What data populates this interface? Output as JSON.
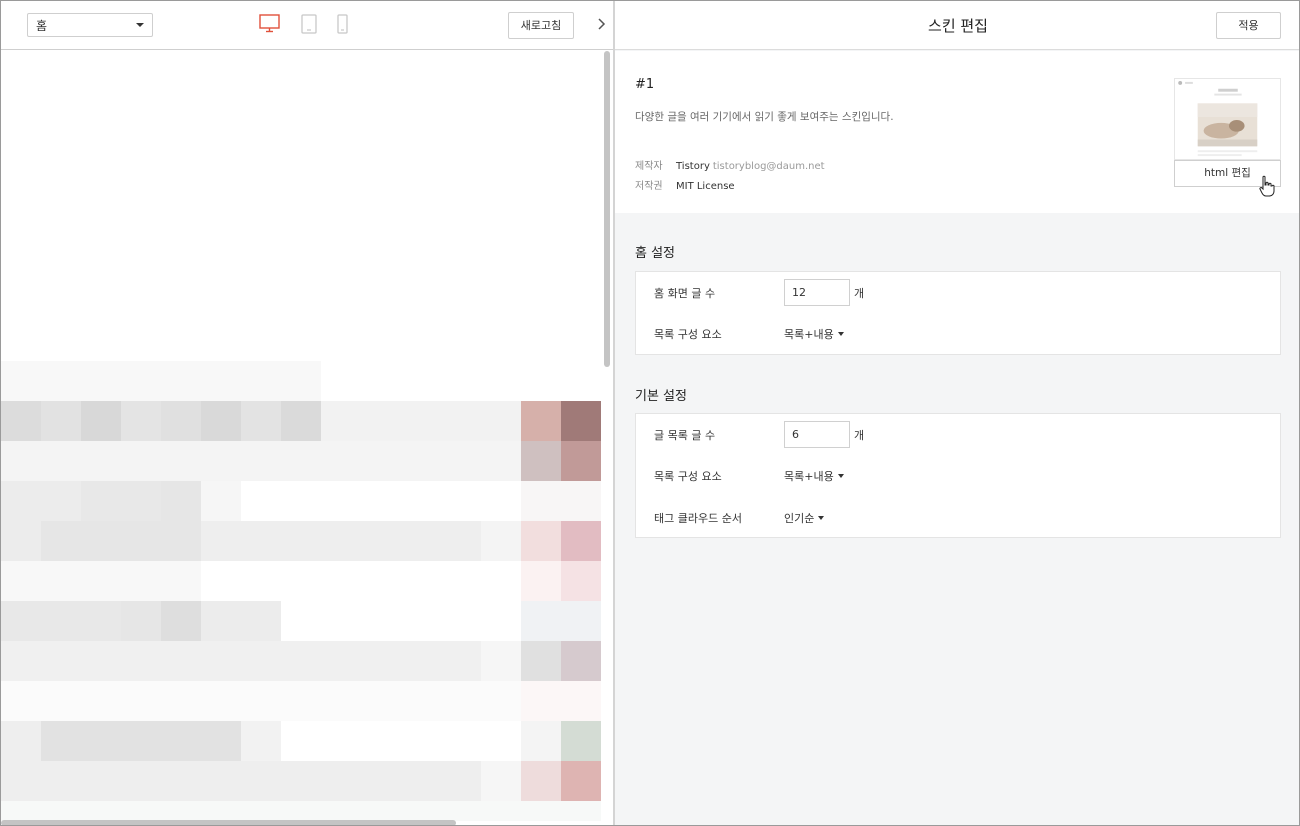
{
  "preview": {
    "page_select": "홈",
    "refresh_label": "새로고침"
  },
  "editor": {
    "title": "스킨 편집",
    "apply_label": "적용",
    "skin": {
      "number": "#1",
      "description": "다양한 글을 여러 기기에서 읽기 좋게 보여주는 스킨입니다.",
      "maker_label": "제작자",
      "maker_name": "Tistory",
      "maker_email": "tistoryblog@daum.net",
      "license_label": "저작권",
      "license_value": "MIT License",
      "html_edit_label": "html 편집"
    },
    "home_settings": {
      "title": "홈 설정",
      "post_count_label": "홈 화면 글 수",
      "post_count": "12",
      "unit": "개",
      "list_element_label": "목록 구성 요소",
      "list_element_value": "목록+내용"
    },
    "basic_settings": {
      "title": "기본 설정",
      "list_count_label": "글 목록 글 수",
      "list_count": "6",
      "unit": "개",
      "list_element_label": "목록 구성 요소",
      "list_element_value": "목록+내용",
      "tag_cloud_label": "태그 클라우드 순서",
      "tag_cloud_value": "인기순"
    }
  },
  "colors": {
    "active_device": "#e0513b",
    "inactive_device": "#c8c8c8",
    "editor_bg": "#f4f5f6"
  }
}
